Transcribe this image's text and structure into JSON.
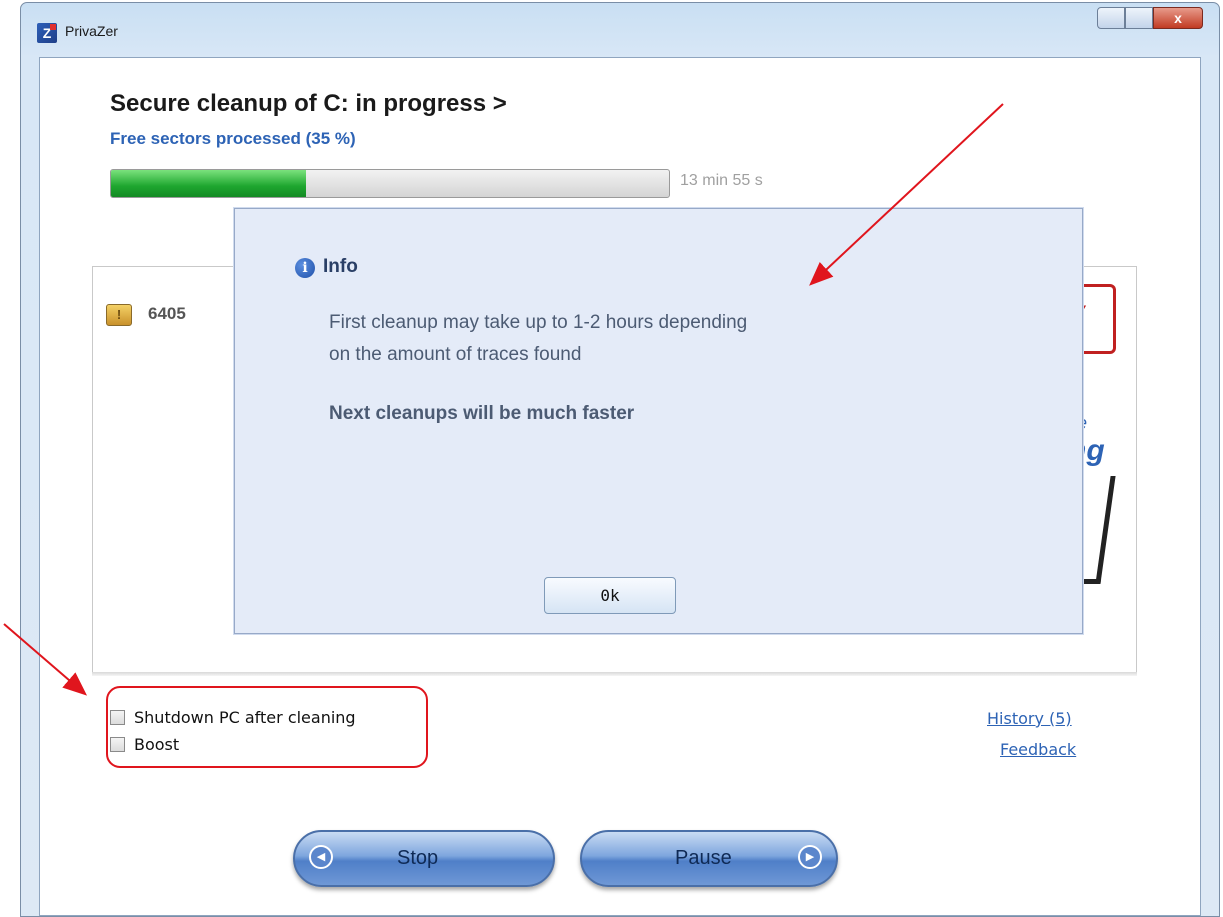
{
  "window": {
    "title": "PrivaZer",
    "close_label": "x"
  },
  "header": {
    "title": "Secure cleanup of C: in progress  >",
    "subtitle": "Free sectors processed (35 %)"
  },
  "progress": {
    "percent": 35,
    "time_remaining": "13 min 55 s"
  },
  "panel": {
    "count_text": "6405",
    "stamp_text": "Y",
    "promo_line1": "ce",
    "promo_line2": "ng"
  },
  "dialog": {
    "title": "Info",
    "message_line1": "First cleanup may take up to 1-2 hours depending",
    "message_line2": "on the amount of traces found",
    "emphasis": "Next cleanups will be much faster",
    "ok_label": "0k"
  },
  "options": {
    "shutdown_label": "Shutdown PC after cleaning",
    "boost_label": "Boost"
  },
  "links": {
    "history": "History (5)",
    "feedback": "Feedback"
  },
  "buttons": {
    "stop": "Stop",
    "pause": "Pause"
  },
  "colors": {
    "accent_blue": "#2d63b5",
    "progress_green": "#1ea62f",
    "annotation_red": "#e0151d"
  }
}
